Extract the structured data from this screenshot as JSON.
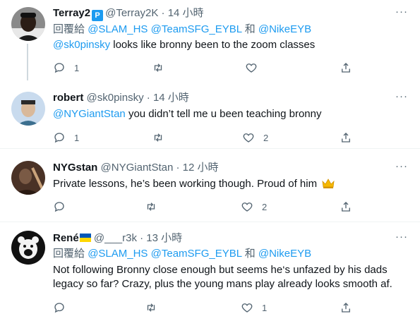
{
  "tweets": [
    {
      "name": "Terray2",
      "badge": "P",
      "handle": "@Terray2K",
      "sep": "·",
      "time": "14 小時",
      "reply_prefix": "回覆給",
      "reply_to": [
        "@SLAM_HS",
        "@TeamSFG_EYBL",
        "@NikeEYB"
      ],
      "reply_and": "和",
      "mention": "@sk0pinsky",
      "text": " looks like bronny been to the zoom classes",
      "reply_count": "1",
      "retweet_count": "",
      "like_count": "",
      "avatar_bg": "#3a3a3a"
    },
    {
      "name": "robert",
      "handle": "@sk0pinsky",
      "sep": "·",
      "time": "14 小時",
      "mention": "@NYGiantStan",
      "text": " you didn’t tell me u been teaching bronny",
      "reply_count": "1",
      "retweet_count": "",
      "like_count": "2",
      "avatar_bg": "#bcd3e8"
    },
    {
      "name": "NYGstan",
      "handle": "@NYGiantStan",
      "sep": "·",
      "time": "12 小時",
      "text": "Private lessons, he’s been working though. Proud of him",
      "emoji": "crown",
      "reply_count": "",
      "retweet_count": "",
      "like_count": "2",
      "avatar_bg": "#6b4a3a"
    },
    {
      "name": "René",
      "flag": "ukraine-flag",
      "handle": "@___r3k",
      "sep": "·",
      "time": "13 小時",
      "reply_prefix": "回覆給",
      "reply_to": [
        "@SLAM_HS",
        "@TeamSFG_EYBL",
        "@NikeEYB"
      ],
      "reply_and": "和",
      "text_line1": "Not following Bronny close enough but seems he‘s unfazed by his dads",
      "text_line2": "legacy so far? Crazy, plus the young mans play already looks smooth af.",
      "reply_count": "",
      "retweet_count": "",
      "like_count": "1",
      "avatar_bg": "#111111"
    }
  ],
  "colors": {
    "link": "#1d9bf0",
    "muted": "#536471",
    "text": "#0f1419",
    "thread_line": "#cfd9de"
  },
  "more_label": "···"
}
